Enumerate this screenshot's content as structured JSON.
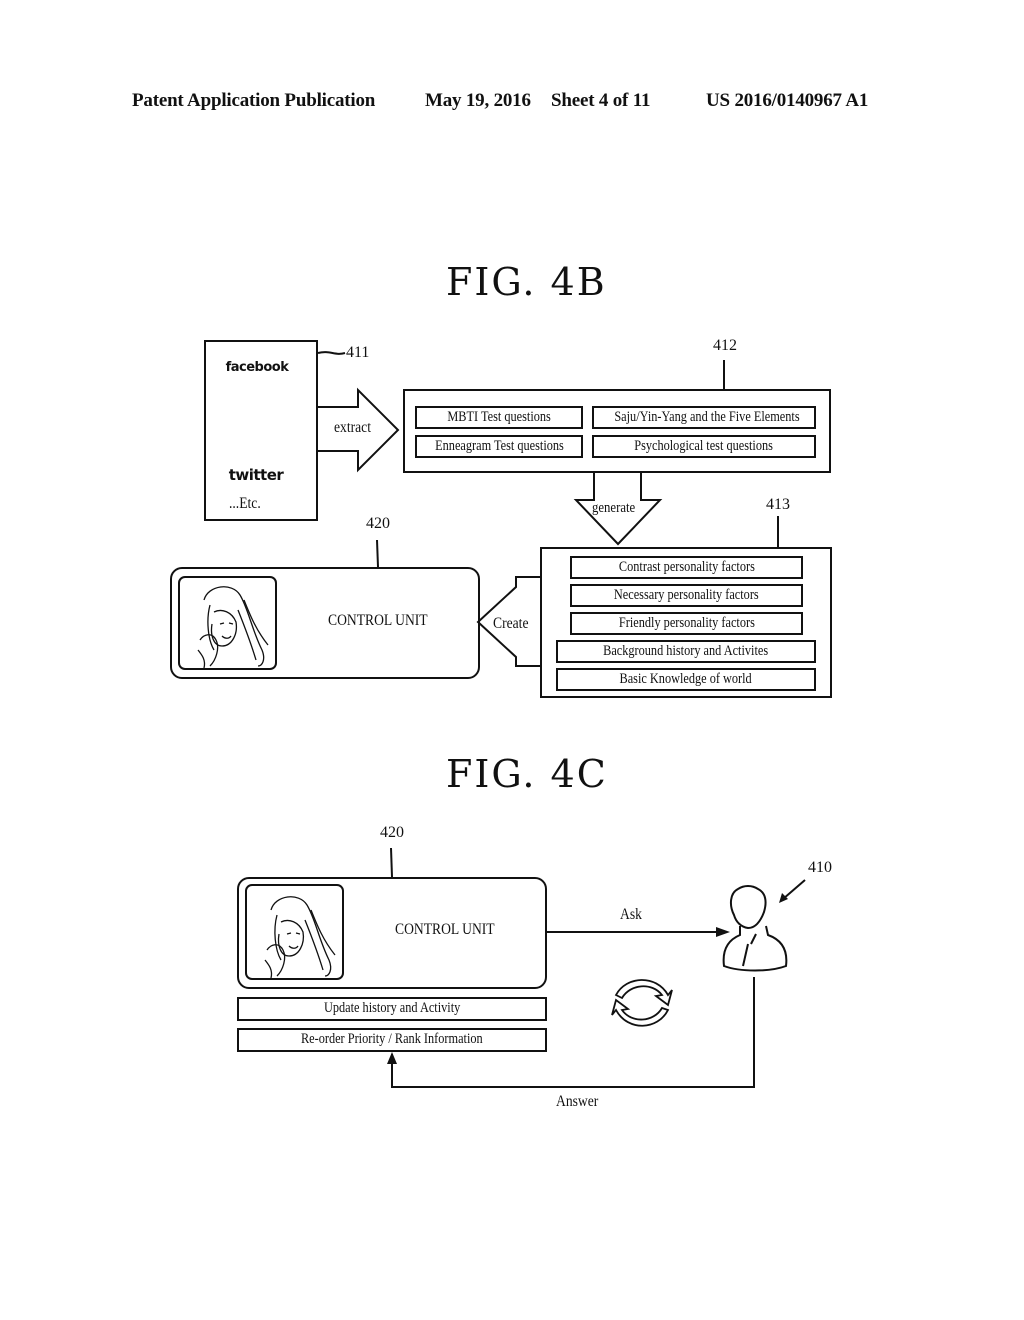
{
  "header": {
    "publication": "Patent Application Publication",
    "date": "May 19, 2016",
    "sheet": "Sheet 4 of 11",
    "number": "US 2016/0140967 A1"
  },
  "fig4b": {
    "title": "FIG. 4B",
    "sources": {
      "ref": "411",
      "icons": [
        "facebook-logo",
        "mail-envelope",
        "twitter-logo"
      ],
      "facebook_text": "facebook",
      "twitter_text": "twitter",
      "etc": "...Etc."
    },
    "extract_label": "extract",
    "questions": {
      "ref": "412",
      "items": [
        "MBTI Test questions",
        "Saju/Yin-Yang and the Five Elements",
        "Enneagram Test questions",
        "Psychological test questions"
      ]
    },
    "generate_label": "generate",
    "factors": {
      "ref": "413",
      "items": [
        "Contrast personality factors",
        "Necessary personality factors",
        "Friendly personality factors",
        "Background history and Activites",
        "Basic Knowledge of world"
      ]
    },
    "create_label": "Create",
    "control_unit": {
      "ref": "420",
      "label": "CONTROL UNIT",
      "image": "woman-portrait-sketch"
    }
  },
  "fig4c": {
    "title": "FIG. 4C",
    "control_unit": {
      "ref": "420",
      "label": "CONTROL UNIT",
      "image": "woman-portrait-sketch"
    },
    "items": [
      "Update history and Activity",
      "Re-order Priority / Rank Information"
    ],
    "ask_label": "Ask",
    "answer_label": "Answer",
    "user": {
      "ref": "410",
      "icon": "user-avatar"
    },
    "cycle_icon": "refresh-cycle"
  }
}
